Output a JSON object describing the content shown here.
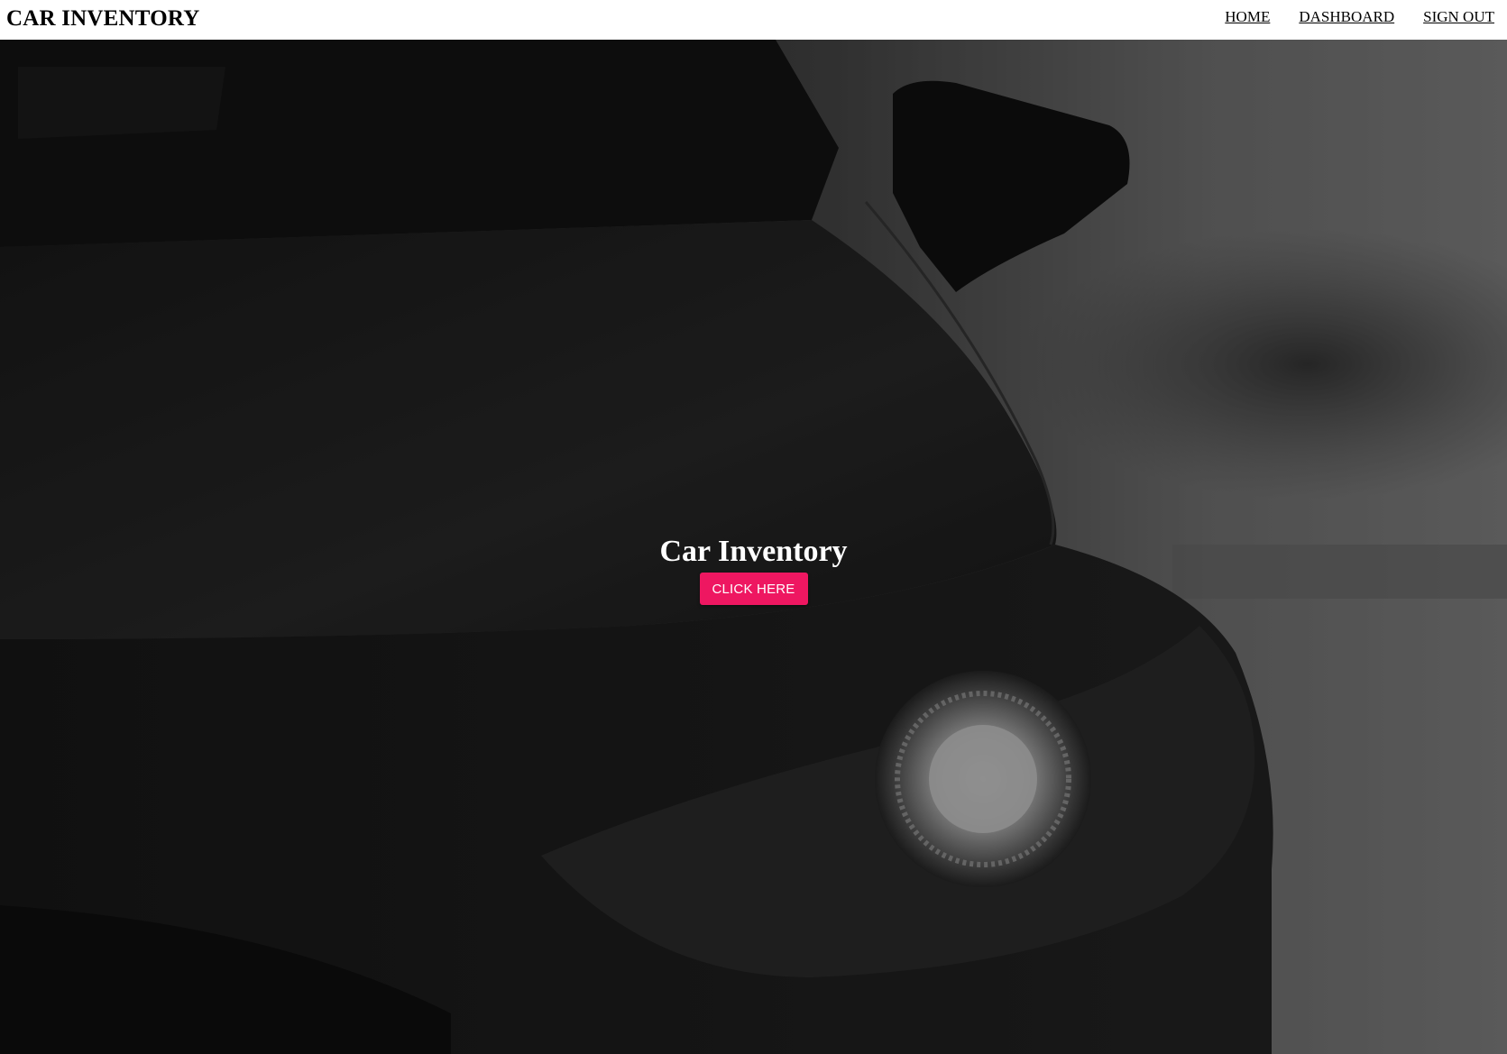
{
  "header": {
    "brand": "CAR INVENTORY",
    "nav": [
      {
        "label": "HOME"
      },
      {
        "label": "DASHBOARD"
      },
      {
        "label": "SIGN OUT"
      }
    ]
  },
  "hero": {
    "title": "Car Inventory",
    "button_label": "CLICK HERE",
    "background_image": "car-headlight-photo",
    "button_color": "#ee1761"
  }
}
